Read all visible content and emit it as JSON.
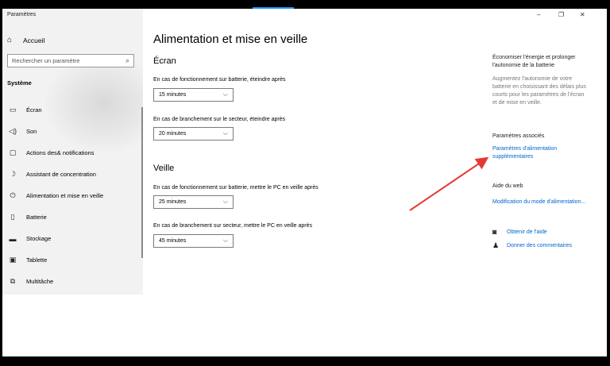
{
  "window": {
    "app_title": "Paramètres",
    "controls": {
      "minimize": "–",
      "restore": "❐",
      "close": "✕"
    }
  },
  "sidebar": {
    "home_label": "Accueil",
    "search_placeholder": "Rechercher un paramètre",
    "section_label": "Système",
    "items": [
      {
        "label": "Écran",
        "icon": "monitor-icon"
      },
      {
        "label": "Son",
        "icon": "speaker-icon"
      },
      {
        "label": "Actions des& notifications",
        "icon": "notification-icon"
      },
      {
        "label": "Assistant de concentration",
        "icon": "moon-icon"
      },
      {
        "label": "Alimentation et mise en veille",
        "icon": "power-icon"
      },
      {
        "label": "Batterie",
        "icon": "battery-icon"
      },
      {
        "label": "Stockage",
        "icon": "storage-icon"
      },
      {
        "label": "Tablette",
        "icon": "tablet-icon"
      },
      {
        "label": "Multitâche",
        "icon": "multitask-icon"
      }
    ]
  },
  "main": {
    "title": "Alimentation et mise en veille",
    "screen": {
      "heading": "Écran",
      "battery_label": "En cas de fonctionnement sur batterie, éteindre après",
      "battery_value": "15 minutes",
      "plugged_label": "En cas de branchement sur le secteur, éteindre après",
      "plugged_value": "20 minutes"
    },
    "sleep": {
      "heading": "Veille",
      "battery_label": "En cas de fonctionnement sur batterie, mettre le PC en veille après",
      "battery_value": "25 minutes",
      "plugged_label": "En cas de branchement sur secteur, mettre le PC en veille après",
      "plugged_value": "45 minutes"
    }
  },
  "right": {
    "save_heading_1": "Économiser l'énergie et prolonger",
    "save_heading_2": "l'autonomie de la batterie",
    "save_desc_1": "Augmentez l'autonomie de votre",
    "save_desc_2": "batterie en choisissant des délais plus",
    "save_desc_3": "courts pour les paramètres de l'écran",
    "save_desc_4": "et de mise en veille.",
    "related_heading": "Paramètres associés",
    "related_link_1": "Paramètres d'alimentation",
    "related_link_2": "supplémentaires",
    "web_heading": "Aide du web",
    "web_link": "Modification du mode d'alimentation...",
    "get_help": "Obtenir de l'aide",
    "feedback": "Donner des commentaires"
  },
  "colors": {
    "accent": "#0066cc",
    "arrow": "#e53935",
    "sidebar_bg": "#f2f2f2"
  }
}
